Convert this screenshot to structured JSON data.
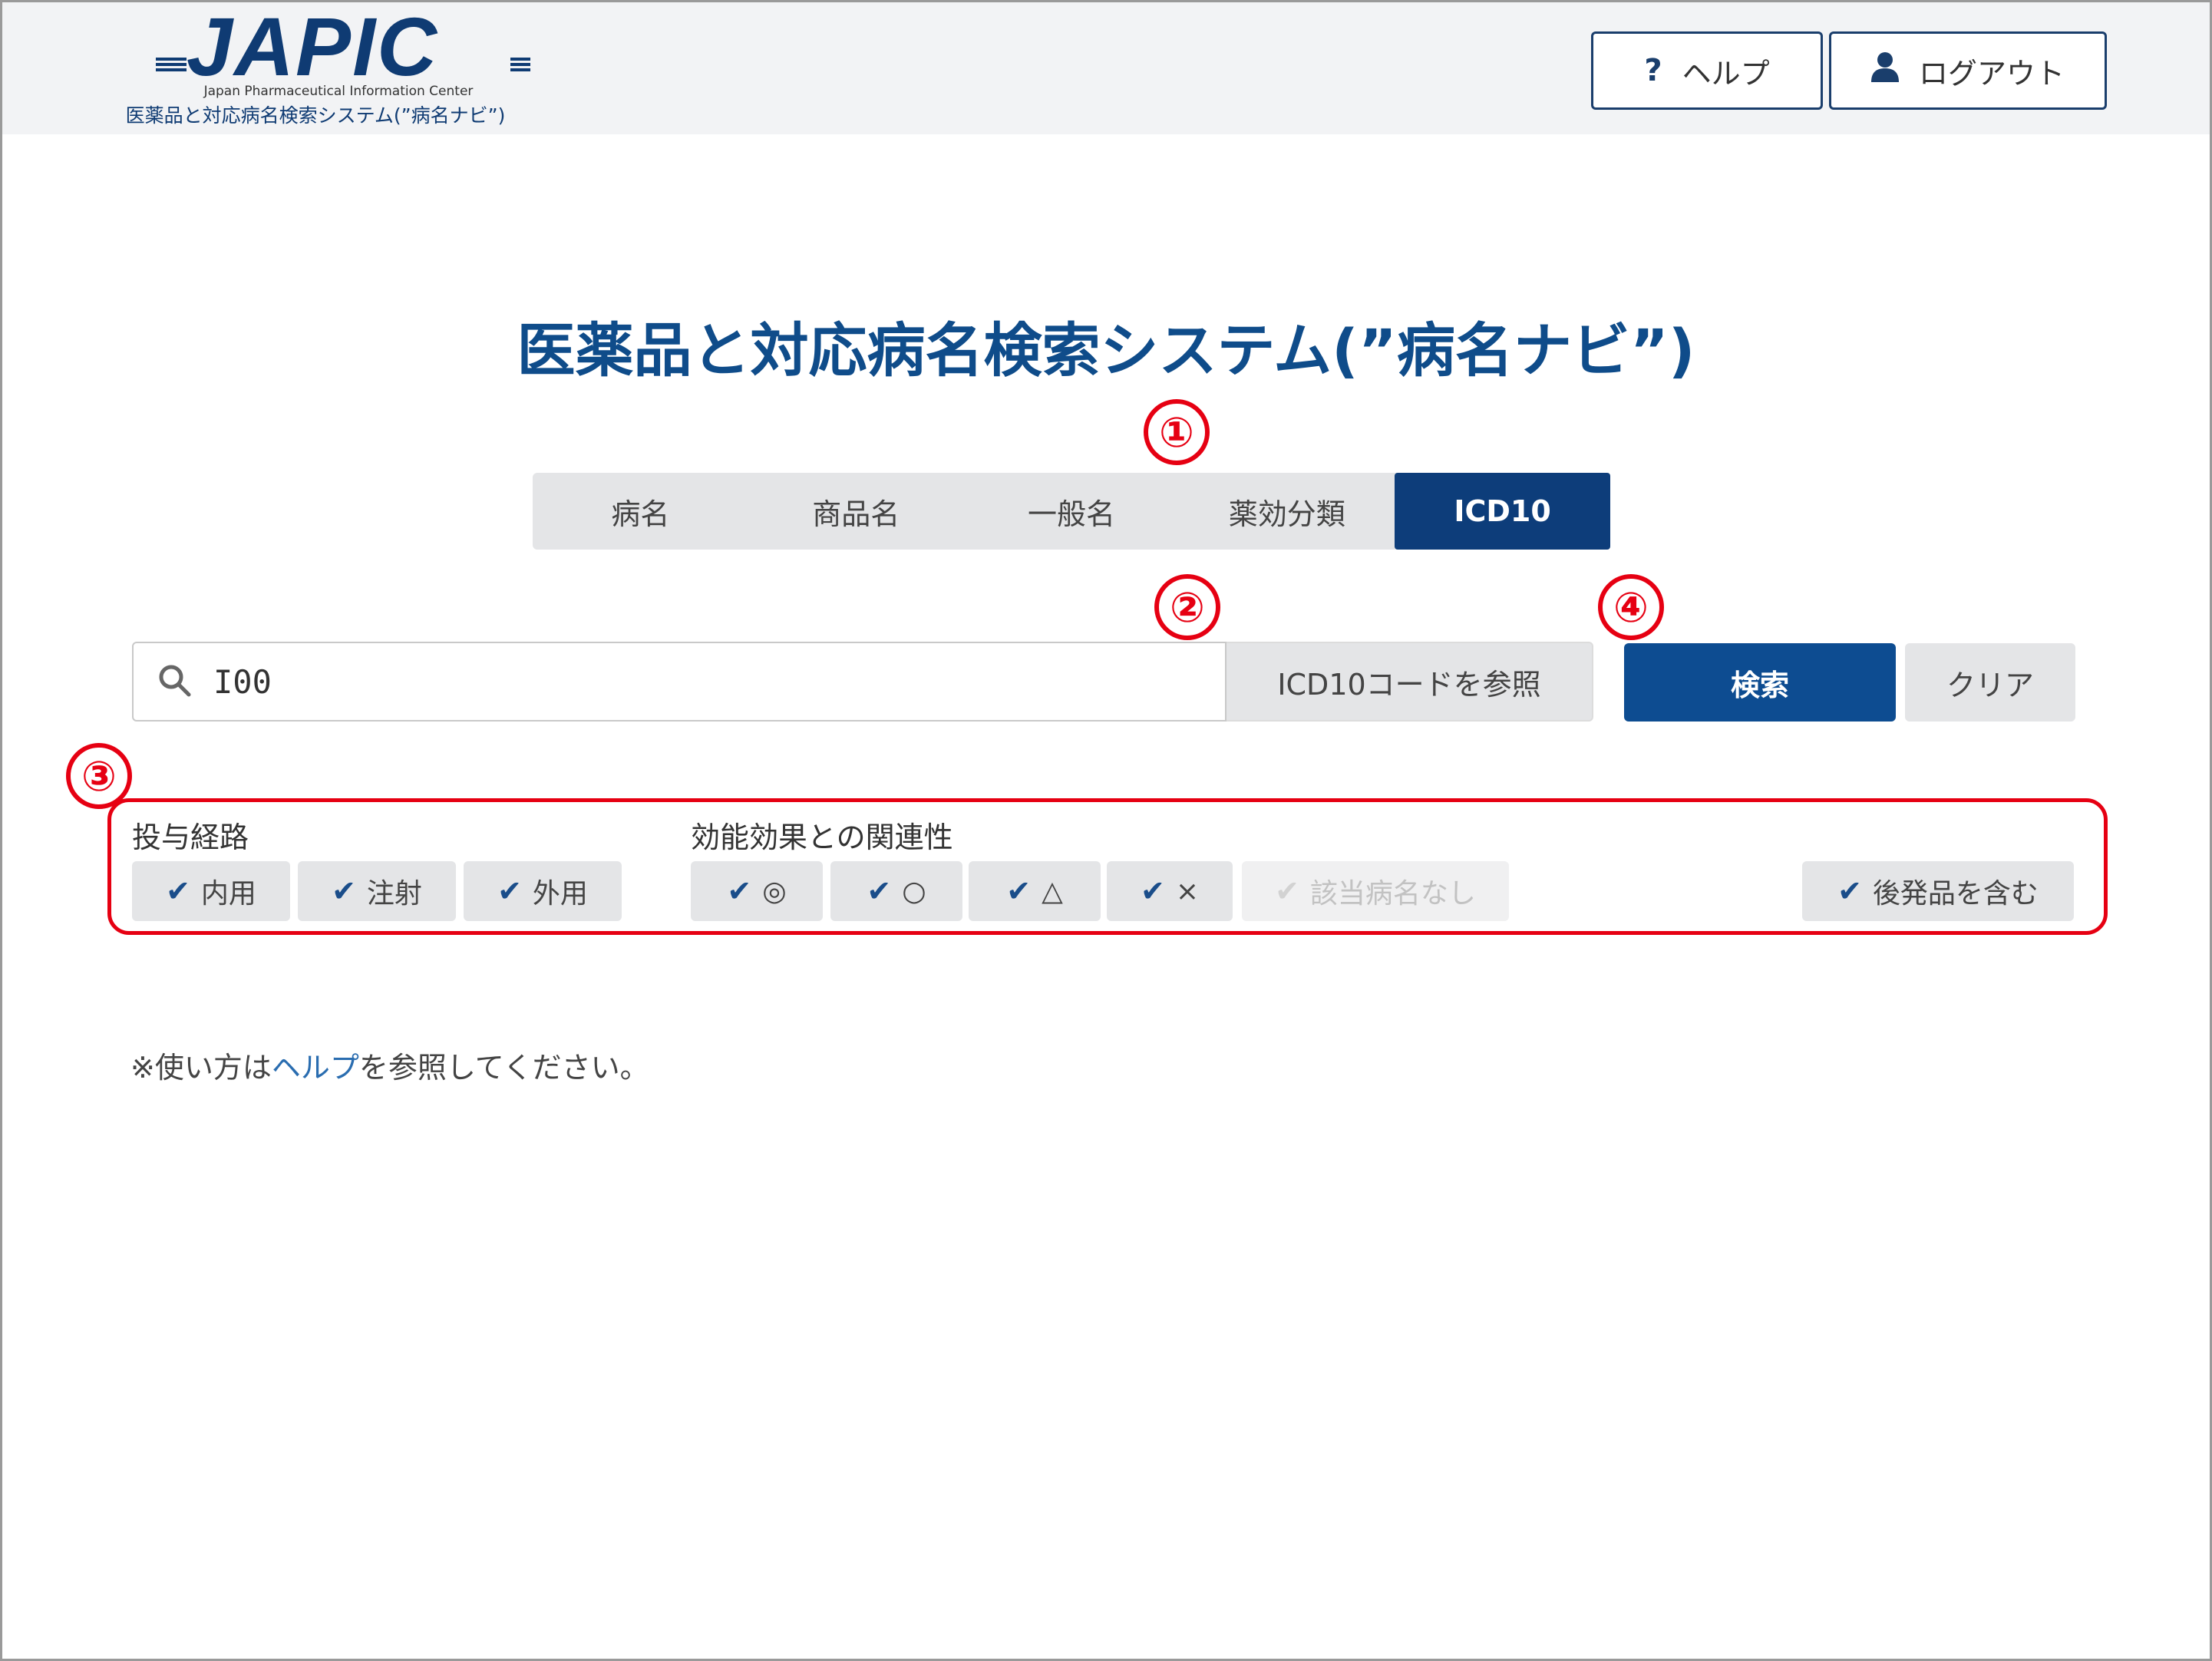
{
  "header": {
    "logo_text": "JAPIC",
    "logo_subtitle": "Japan Pharmaceutical Information Center",
    "logo_system_name": "医薬品と対応病名検索システム(”病名ナビ”)",
    "help_label": "ヘルプ",
    "logout_label": "ログアウト",
    "help_icon": "?",
    "user_icon": "user-icon"
  },
  "title": "医薬品と対応病名検索システム(”病名ナビ”)",
  "markers": [
    "①",
    "②",
    "③",
    "④"
  ],
  "tabs": [
    {
      "label": "病名",
      "active": false
    },
    {
      "label": "商品名",
      "active": false
    },
    {
      "label": "一般名",
      "active": false
    },
    {
      "label": "薬効分類",
      "active": false
    },
    {
      "label": "ICD10",
      "active": true
    }
  ],
  "search": {
    "value": "I00",
    "ref_button_label": "ICD10コードを参照",
    "search_button_label": "検索",
    "clear_button_label": "クリア"
  },
  "filters": {
    "route_label": "投与経路",
    "route_options": [
      "内用",
      "注射",
      "外用"
    ],
    "relation_label": "効能効果との関連性",
    "relation_options": [
      "◎",
      "○",
      "△",
      "×"
    ],
    "no_match_label": "該当病名なし",
    "generic_label": "後発品を含む"
  },
  "note": {
    "prefix": "※使い方は",
    "link": "ヘルプ",
    "suffix": "を参照してください。"
  },
  "colors": {
    "brand": "#0f3b73",
    "active_tab": "#0d3d7a",
    "primary_button": "#0d4c91",
    "annotation": "#e60012",
    "link": "#2a6db0"
  }
}
